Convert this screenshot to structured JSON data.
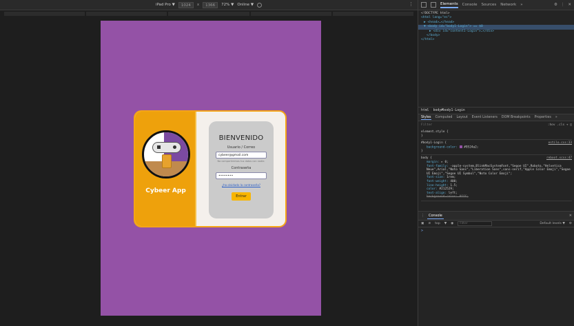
{
  "device_toolbar": {
    "device": "iPad Pro ▼",
    "width": "1024",
    "x": "x",
    "height": "1366",
    "zoom": "72% ▼",
    "throttle": "Online ▼",
    "menu": "⋮"
  },
  "login": {
    "app_name": "Cybeer App",
    "title": "BIENVENIDO",
    "email_label": "Usuario / Correo",
    "email_value": "cybeer@gmail.com",
    "email_help": "No compartiremos tus datos con nadie.",
    "password_label": "Contraseña",
    "password_value": "••••••••",
    "forgot_link": "¿ha olvidado la contraseña?",
    "submit": "Entrar"
  },
  "devtools": {
    "tabs": [
      "Elements",
      "Console",
      "Sources",
      "Network",
      "»"
    ],
    "tree": {
      "doctype": "<!DOCTYPE html>",
      "html_open": "<html lang=\"es\">",
      "head": "▶ <head>…</head>",
      "body": "▼ <body id=\"body1-Login\"> == $0",
      "div": "▶ <div id=\"content1-Login\">…</div>",
      "body_close": "</body>",
      "html_close": "</html>"
    },
    "breadcrumbs": [
      "html",
      "body#body1-Login"
    ],
    "style_tabs": [
      "Styles",
      "Computed",
      "Layout",
      "Event Listeners",
      "DOM Breakpoints",
      "Properties",
      "»"
    ],
    "filter_placeholder": "Filter",
    "filter_tools": ":hov .cls + ◫",
    "rules": {
      "element_style": "element.style {",
      "r1_selector": "#body1-Login {",
      "r1_src": "estilo.css:33",
      "r1_prop": "background-color:",
      "r1_val": "#9524a2;",
      "r2_selector": "body {",
      "r2_src": "reboot.scss:47",
      "p_margin": "margin:",
      "v_margin": "▸ 0;",
      "p_font_family": "font-family:",
      "v_font_family": "-apple-system,BlinkMacSystemFont,\"Segoe UI\",Roboto,\"Helvetica Neue\",Arial,\"Noto Sans\",\"Liberation Sans\",sans-serif,\"Apple Color Emoji\",\"Segoe UI Emoji\",\"Segoe UI Symbol\",\"Noto Color Emoji\";",
      "p_font_size": "font-size:",
      "v_font_size": "1rem;",
      "p_font_weight": "font-weight:",
      "v_font_weight": "400;",
      "p_line_height": "line-height:",
      "v_line_height": "1.5;",
      "p_color": "color:",
      "v_color": "#212529;",
      "p_text_align": "text-align:",
      "v_text_align": "left;",
      "p_bg_struck": "background-color: #fff;",
      "close": "}"
    },
    "console": {
      "tab": "Console",
      "context": "top",
      "filter_placeholder": "Filter",
      "levels": "Default levels ▼",
      "prompt": ">"
    }
  }
}
